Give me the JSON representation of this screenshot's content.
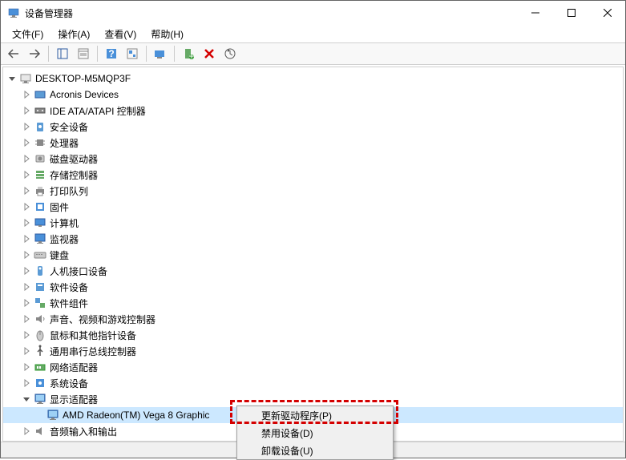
{
  "window": {
    "title": "设备管理器"
  },
  "menu": {
    "file": "文件(F)",
    "action": "操作(A)",
    "view": "查看(V)",
    "help": "帮助(H)"
  },
  "tree": {
    "root": "DESKTOP-M5MQP3F",
    "items": [
      {
        "label": "Acronis Devices",
        "icon": "device-generic"
      },
      {
        "label": "IDE ATA/ATAPI 控制器",
        "icon": "ide"
      },
      {
        "label": "安全设备",
        "icon": "security"
      },
      {
        "label": "处理器",
        "icon": "cpu"
      },
      {
        "label": "磁盘驱动器",
        "icon": "disk"
      },
      {
        "label": "存储控制器",
        "icon": "storage"
      },
      {
        "label": "打印队列",
        "icon": "printer"
      },
      {
        "label": "固件",
        "icon": "firmware"
      },
      {
        "label": "计算机",
        "icon": "computer"
      },
      {
        "label": "监视器",
        "icon": "monitor"
      },
      {
        "label": "键盘",
        "icon": "keyboard"
      },
      {
        "label": "人机接口设备",
        "icon": "hid"
      },
      {
        "label": "软件设备",
        "icon": "software"
      },
      {
        "label": "软件组件",
        "icon": "software-comp"
      },
      {
        "label": "声音、视频和游戏控制器",
        "icon": "audio"
      },
      {
        "label": "鼠标和其他指针设备",
        "icon": "mouse"
      },
      {
        "label": "通用串行总线控制器",
        "icon": "usb"
      },
      {
        "label": "网络适配器",
        "icon": "network"
      },
      {
        "label": "系统设备",
        "icon": "system"
      },
      {
        "label": "显示适配器",
        "icon": "display",
        "expanded": true,
        "children": [
          {
            "label": "AMD Radeon(TM) Vega 8 Graphic",
            "icon": "display",
            "selected": true
          }
        ]
      },
      {
        "label": "音频输入和输出",
        "icon": "audio-io"
      }
    ]
  },
  "context_menu": {
    "update_driver": "更新驱动程序(P)",
    "disable_device": "禁用设备(D)",
    "uninstall_device": "卸载设备(U)"
  }
}
